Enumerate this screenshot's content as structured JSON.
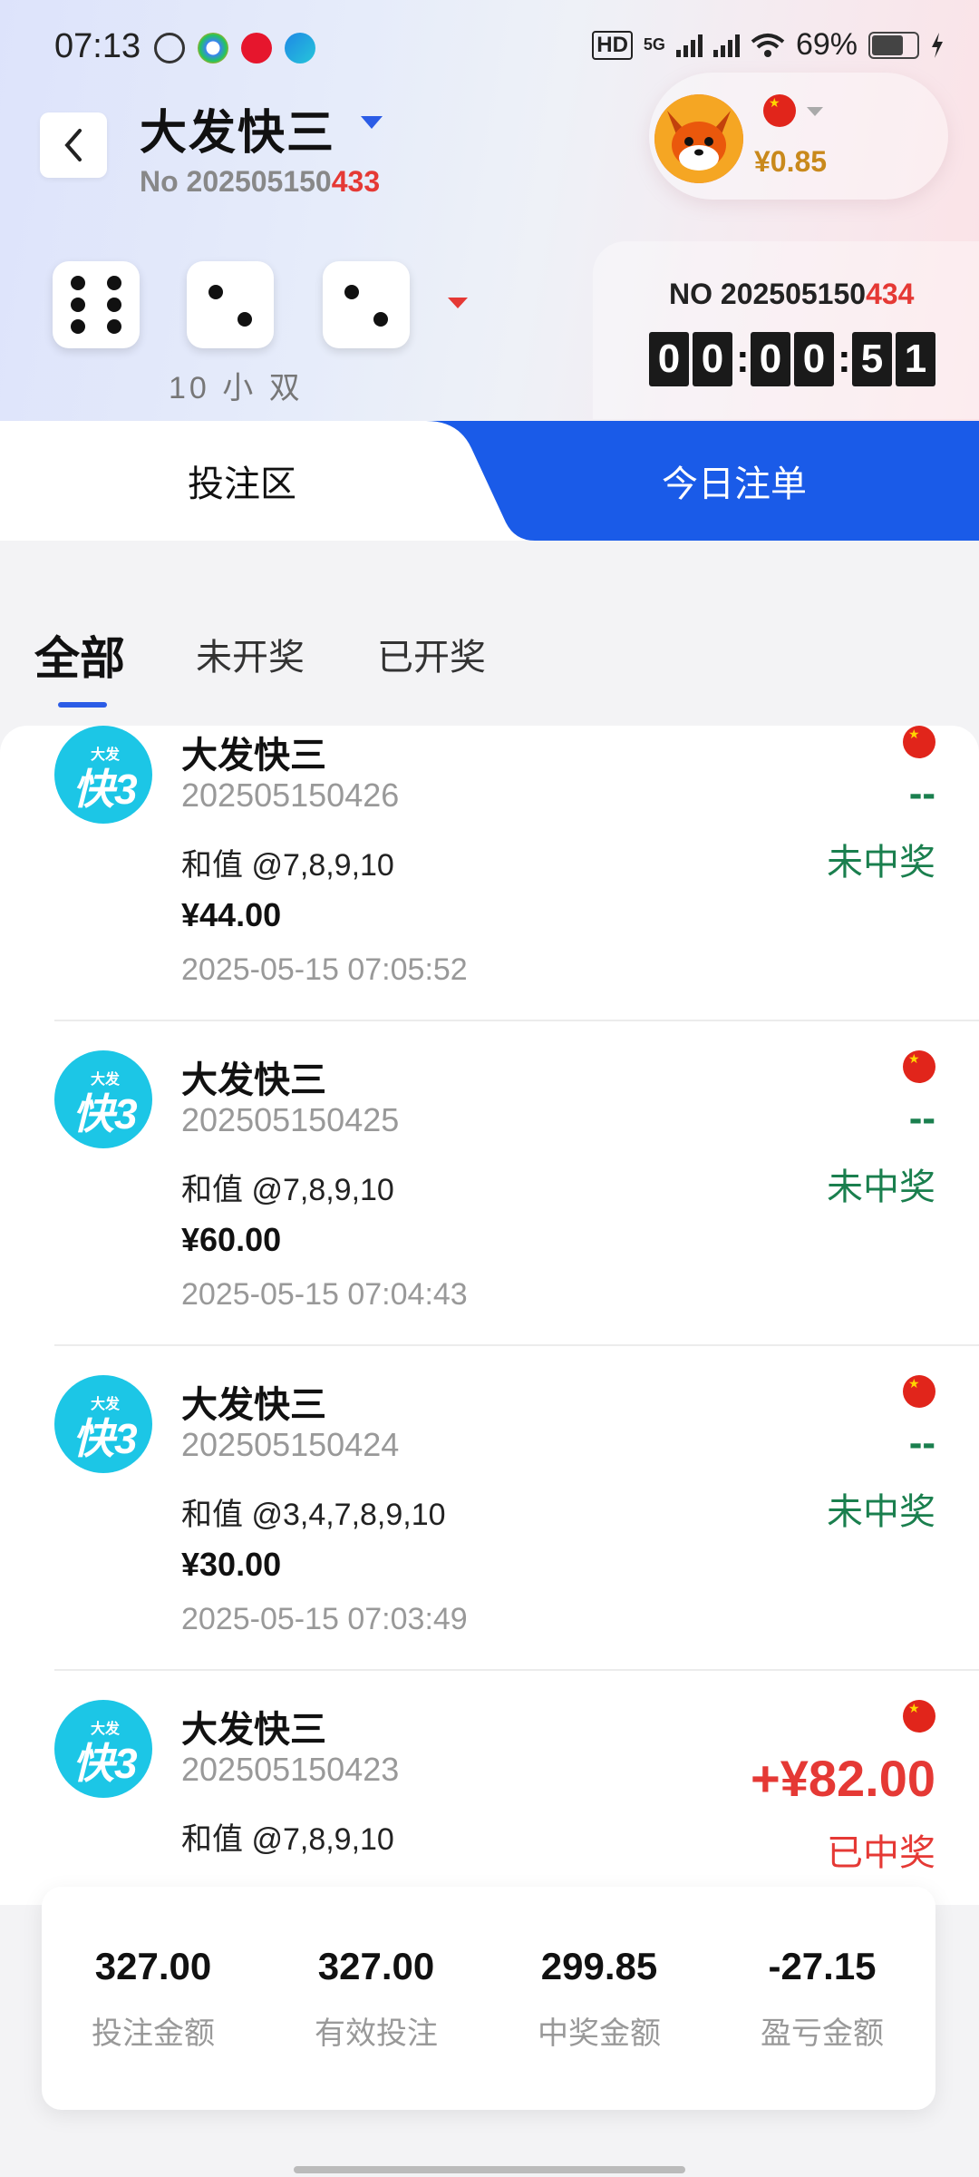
{
  "status_bar": {
    "time": "07:13",
    "battery": "69%",
    "hd_label": "HD",
    "net_label": "5G"
  },
  "header": {
    "game_name": "大发快三",
    "issue_prefix": "No 202505150",
    "issue_suffix": "433",
    "balance": "¥0.85"
  },
  "last_result": {
    "dice": [
      6,
      2,
      2
    ],
    "summary": "10 小 双"
  },
  "next_draw": {
    "no_prefix": "NO 202505150",
    "no_suffix": "434",
    "countdown": [
      "0",
      "0",
      "0",
      "0",
      "5",
      "1"
    ]
  },
  "main_tabs": {
    "bet_area": "投注区",
    "today_orders": "今日注单"
  },
  "filters": {
    "all": "全部",
    "pending": "未开奖",
    "drawn": "已开奖"
  },
  "orders": [
    {
      "logo_top": "大发",
      "logo_main": "快3",
      "name": "大发快三",
      "issue": "202505150426",
      "pick": "和值 @7,8,9,10",
      "amount": "¥44.00",
      "time": "2025-05-15 07:05:52",
      "win": "--",
      "status": "未中奖",
      "won": false
    },
    {
      "logo_top": "大发",
      "logo_main": "快3",
      "name": "大发快三",
      "issue": "202505150425",
      "pick": "和值 @7,8,9,10",
      "amount": "¥60.00",
      "time": "2025-05-15 07:04:43",
      "win": "--",
      "status": "未中奖",
      "won": false
    },
    {
      "logo_top": "大发",
      "logo_main": "快3",
      "name": "大发快三",
      "issue": "202505150424",
      "pick": "和值 @3,4,7,8,9,10",
      "amount": "¥30.00",
      "time": "2025-05-15 07:03:49",
      "win": "--",
      "status": "未中奖",
      "won": false
    },
    {
      "logo_top": "大发",
      "logo_main": "快3",
      "name": "大发快三",
      "issue": "202505150423",
      "pick": "和值 @7,8,9,10",
      "amount": "",
      "time": "",
      "win": "+¥82.00",
      "status": "已中奖",
      "won": true
    }
  ],
  "summary": {
    "bet_amount_value": "327.00",
    "bet_amount_label": "投注金额",
    "valid_bet_value": "327.00",
    "valid_bet_label": "有效投注",
    "prize_value": "299.85",
    "prize_label": "中奖金额",
    "profit_value": "-27.15",
    "profit_label": "盈亏金额"
  },
  "colors": {
    "accent_blue": "#1a5be8",
    "win_red": "#e53935",
    "lose_green": "#1a7f4e",
    "balance_gold": "#c9891b",
    "logo_cyan": "#1cc6e6"
  }
}
